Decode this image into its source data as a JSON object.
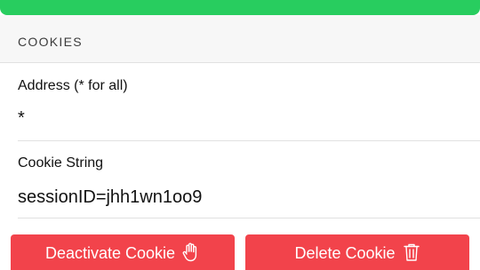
{
  "section": {
    "title": "COOKIES"
  },
  "address_field": {
    "label": "Address (* for all)",
    "value": "*"
  },
  "cookie_field": {
    "label": "Cookie String",
    "value": "sessionID=jhh1wn1oo9"
  },
  "actions": {
    "deactivate_label": "Deactivate Cookie",
    "deactivate_icon": "hand-stop-icon",
    "delete_label": "Delete Cookie",
    "delete_icon": "trash-icon"
  },
  "colors": {
    "top_bar": "#28cd5f",
    "button_red": "#f2434b",
    "section_bg": "#f7f7f7",
    "divider": "#e1e1e1"
  }
}
